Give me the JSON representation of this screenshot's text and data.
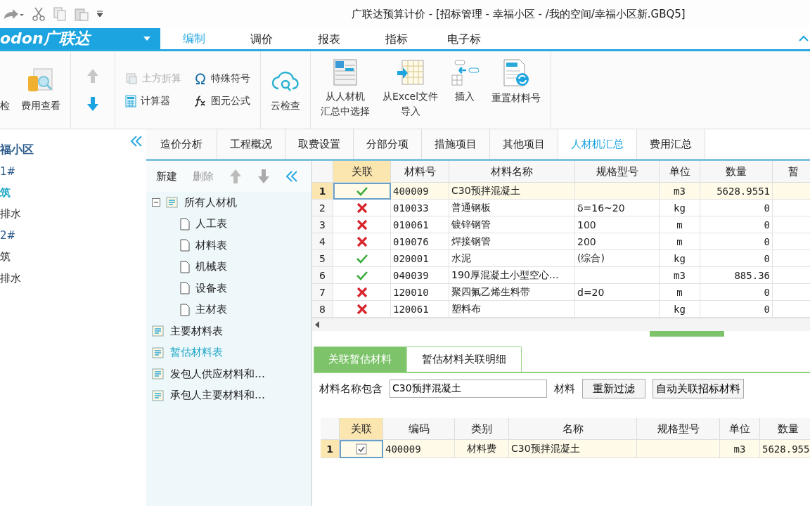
{
  "title_bar": {
    "title": "广联达预算计价 - [招标管理 - 幸福小区 - /我的空间/幸福小区新.GBQ5]"
  },
  "logo": {
    "text": "odon广联达"
  },
  "ribbon_tabs": [
    {
      "label": "编制",
      "selected": true
    },
    {
      "label": "调价",
      "selected": false
    },
    {
      "label": "报表",
      "selected": false
    },
    {
      "label": "指标",
      "selected": false
    },
    {
      "label": "电子标",
      "selected": false
    }
  ],
  "ribbon": {
    "cut_label": "检",
    "fee_view": "费用查看",
    "small_tools": [
      {
        "label": "土方折算",
        "disabled": true
      },
      {
        "label": "特殊符号",
        "disabled": false
      },
      {
        "label": "计算器",
        "disabled": false
      },
      {
        "label": "图元公式",
        "disabled": false
      }
    ],
    "cloud_check": "云检查",
    "large_tools": [
      {
        "lines": [
          "从人材机",
          "汇总中选择"
        ]
      },
      {
        "lines": [
          "从Excel文件",
          "导入"
        ]
      },
      {
        "lines": [
          "插入"
        ]
      },
      {
        "lines": [
          "重置材料号"
        ]
      }
    ]
  },
  "project_tree": [
    {
      "label": "福小区",
      "kind": "project",
      "selected": false
    },
    {
      "label": "1#",
      "kind": "building",
      "selected": false
    },
    {
      "label": "筑",
      "kind": "unit",
      "selected": true
    },
    {
      "label": "排水",
      "kind": "unit",
      "selected": false
    },
    {
      "label": "2#",
      "kind": "building",
      "selected": false
    },
    {
      "label": "筑",
      "kind": "unit",
      "selected": false
    },
    {
      "label": "排水",
      "kind": "unit",
      "selected": false
    }
  ],
  "view_tabs": [
    {
      "label": "造价分析",
      "selected": false
    },
    {
      "label": "工程概况",
      "selected": false
    },
    {
      "label": "取费设置",
      "selected": false
    },
    {
      "label": "分部分项",
      "selected": false
    },
    {
      "label": "措施项目",
      "selected": false
    },
    {
      "label": "其他项目",
      "selected": false
    },
    {
      "label": "人材机汇总",
      "selected": true
    },
    {
      "label": "费用汇总",
      "selected": false
    }
  ],
  "category_toolbar": {
    "new": "新建",
    "delete": {
      "label": "删除",
      "disabled": true
    }
  },
  "category_tree": [
    {
      "label": "所有人材机",
      "expanded": true,
      "selected": false,
      "children": [
        {
          "label": "人工表",
          "selected": false
        },
        {
          "label": "材料表",
          "selected": false
        },
        {
          "label": "机械表",
          "selected": false
        },
        {
          "label": "设备表",
          "selected": false
        },
        {
          "label": "主材表",
          "selected": false
        }
      ]
    },
    {
      "label": "主要材料表",
      "selected": false
    },
    {
      "label": "暂估材料表",
      "selected": true
    },
    {
      "label": "发包人供应材料和…",
      "selected": false
    },
    {
      "label": "承包人主要材料和…",
      "selected": false
    }
  ],
  "materials_table": {
    "columns": [
      "关联",
      "材料号",
      "材料名称",
      "规格型号",
      "单位",
      "数量",
      "暂"
    ],
    "rows": [
      {
        "no": "1",
        "linked": true,
        "code": "400009",
        "name": "C30预拌混凝土",
        "unit": "m3",
        "qty": "5628.9551",
        "selected": true
      },
      {
        "no": "2",
        "linked": false,
        "code": "010033",
        "name": "普通钢板",
        "spec": "δ=16~20",
        "unit": "kg",
        "qty": "0",
        "selected": false
      },
      {
        "no": "3",
        "linked": false,
        "code": "010061",
        "name": "镀锌钢管",
        "spec": "100",
        "unit": "m",
        "qty": "0",
        "selected": false
      },
      {
        "no": "4",
        "linked": false,
        "code": "010076",
        "name": "焊接钢管",
        "spec": "200",
        "unit": "m",
        "qty": "0",
        "selected": false
      },
      {
        "no": "5",
        "linked": true,
        "code": "020001",
        "name": "水泥",
        "spec": "(综合)",
        "unit": "kg",
        "qty": "0",
        "selected": false
      },
      {
        "no": "6",
        "linked": true,
        "code": "040039",
        "name": "190厚混凝土小型空心…",
        "unit": "m3",
        "qty": "885.36",
        "selected": false
      },
      {
        "no": "7",
        "linked": false,
        "code": "120010",
        "name": "聚四氟乙烯生料带",
        "spec": "d=20",
        "unit": "m",
        "qty": "0",
        "selected": false
      },
      {
        "no": "8",
        "linked": false,
        "code": "120061",
        "name": "塑料布",
        "unit": "kg",
        "qty": "0",
        "selected": false
      }
    ]
  },
  "detail_tabs": [
    {
      "label": "关联暂估材料",
      "selected": true
    },
    {
      "label": "暂估材料关联明细",
      "selected": false
    }
  ],
  "filter": {
    "label": "材料名称包含",
    "value": "C30预拌混凝土",
    "suffix": "材料",
    "buttons": [
      "重新过滤",
      "自动关联招标材料"
    ]
  },
  "bid_table": {
    "columns": [
      "关联",
      "编码",
      "类别",
      "名称",
      "规格型号",
      "单位",
      "数量"
    ],
    "rows": [
      {
        "no": "1",
        "checked": true,
        "code": "400009",
        "category": "材料费",
        "name": "C30预拌混凝土",
        "unit": "m3",
        "qty": "5628.955",
        "selected": true
      }
    ]
  }
}
